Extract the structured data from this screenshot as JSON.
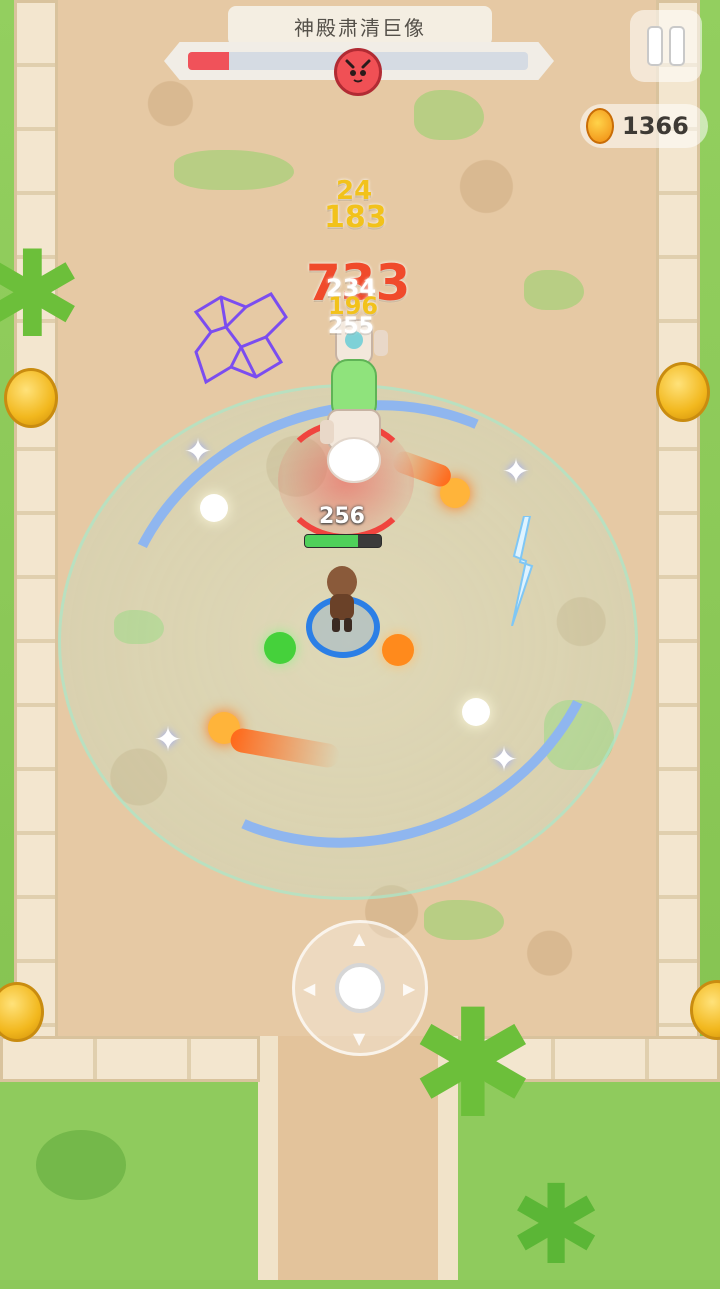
{
  "hud": {
    "boss_name": "神殿肃清巨像",
    "boss_health_fraction": 0.12,
    "boss_icon": "demon-skull-icon",
    "pause_icon": "pause-icon",
    "coin_icon": "gold-coin-icon",
    "coins": "1366"
  },
  "combat": {
    "damage_numbers": [
      {
        "text": "24",
        "color": "#f2c21b"
      },
      {
        "text": "183",
        "color": "#f2c21b"
      },
      {
        "text": "733",
        "color": "#f04a2b"
      },
      {
        "text": "234",
        "color": "#ffffff"
      },
      {
        "text": "196",
        "color": "#f2c21b"
      },
      {
        "text": "255",
        "color": "#ffffff"
      }
    ],
    "player_hp": "256",
    "player_hp_fraction": 0.7
  },
  "controls": {
    "joystick_icon": "virtual-joystick-icon"
  },
  "colors": {
    "grass": "#8fcb5d",
    "floor": "#e6c9a4",
    "boss_red": "#f0525a",
    "player_blue": "#2b7fe6",
    "player_green": "#4fd05a"
  }
}
